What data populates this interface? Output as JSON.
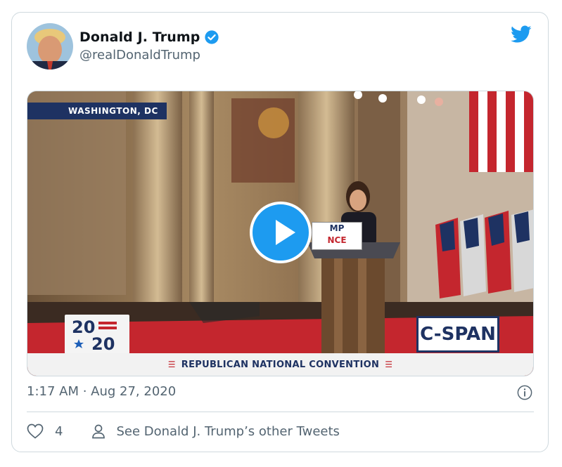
{
  "tweet": {
    "author_name": "Donald J. Trump",
    "handle": "@realDonaldTrump",
    "timestamp": "1:17 AM · Aug 27, 2020",
    "like_count": "4",
    "other_tweets_label": "See Donald J. Trump’s other Tweets"
  },
  "media": {
    "location_badge": "WASHINGTON, DC",
    "network_logo": "C-SPAN",
    "year_logo_top": "20",
    "year_logo_bottom": "20",
    "banner": "REPUBLICAN NATIONAL CONVENTION",
    "podium_line1": "MP",
    "podium_line2": "NCE"
  },
  "icons": {
    "verified": "verified-badge-icon",
    "brand": "twitter-bird-icon",
    "play": "play-icon",
    "info": "info-icon",
    "like": "heart-icon",
    "profile": "person-icon"
  },
  "colors": {
    "accent": "#1d9bf0",
    "text_primary": "#0f1419",
    "text_secondary": "#536471",
    "border": "#cfd9de",
    "cspan_navy": "#1e3262"
  }
}
